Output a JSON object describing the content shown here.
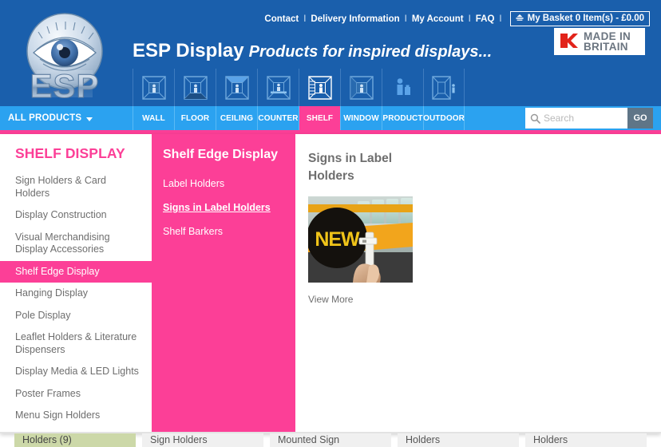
{
  "header": {
    "logo_alt": "ESP eye logo",
    "brand_name": "ESP Display",
    "brand_tagline": "Products for inspired displays...",
    "made_in_britain": {
      "line1": "MADE IN",
      "line2": "BRITAIN"
    },
    "utility_links": [
      {
        "label": "Contact"
      },
      {
        "label": "Delivery Information"
      },
      {
        "label": "My Account"
      },
      {
        "label": "FAQ"
      }
    ],
    "separator": "I",
    "basket": {
      "label": "My Basket 0 Item(s) - £0.00"
    }
  },
  "nav": {
    "all_products_label": "ALL PRODUCTS",
    "items": [
      {
        "label": "WALL",
        "icon": "room-wall-icon",
        "active": false
      },
      {
        "label": "FLOOR",
        "icon": "room-floor-icon",
        "active": false
      },
      {
        "label": "CEILING",
        "icon": "room-ceiling-icon",
        "active": false
      },
      {
        "label": "COUNTER",
        "icon": "room-counter-icon",
        "active": false
      },
      {
        "label": "SHELF",
        "icon": "room-shelf-icon",
        "active": true
      },
      {
        "label": "WINDOW",
        "icon": "room-window-icon",
        "active": false
      },
      {
        "label": "PRODUCT",
        "icon": "product-icon",
        "active": false
      },
      {
        "label": "OUTDOOR",
        "icon": "room-outdoor-icon",
        "active": false
      }
    ]
  },
  "search": {
    "placeholder": "Search",
    "value": "",
    "button_label": "GO"
  },
  "mega_menu": {
    "left": {
      "title": "SHELF DISPLAY",
      "items": [
        {
          "label": "Sign Holders & Card Holders",
          "selected": false
        },
        {
          "label": "Display Construction",
          "selected": false
        },
        {
          "label": "Visual Merchandising Display Accessories",
          "selected": false
        },
        {
          "label": "Shelf Edge Display",
          "selected": true
        },
        {
          "label": "Hanging Display",
          "selected": false
        },
        {
          "label": "Pole Display",
          "selected": false
        },
        {
          "label": "Leaflet Holders & Literature Dispensers",
          "selected": false
        },
        {
          "label": "Display Media & LED Lights",
          "selected": false
        },
        {
          "label": "Poster Frames",
          "selected": false
        },
        {
          "label": "Menu Sign Holders",
          "selected": false
        }
      ]
    },
    "middle": {
      "title": "Shelf Edge Display",
      "items": [
        {
          "label": "Label Holders",
          "current": false
        },
        {
          "label": "Signs in Label Holders",
          "current": true
        },
        {
          "label": "Shelf Barkers",
          "current": false
        }
      ]
    },
    "right": {
      "title": "Signs in Label Holders",
      "thumbnail_alt": "NEW! sign clipped into a shelf label holder",
      "view_more_label": "View More"
    }
  },
  "background_row": [
    {
      "label": "Holders (9)",
      "highlight": true
    },
    {
      "label": "Sign Holders",
      "highlight": false
    },
    {
      "label": "Mounted Sign",
      "highlight": false
    },
    {
      "label": "Holders",
      "highlight": false
    },
    {
      "label": "Holders",
      "highlight": false
    }
  ],
  "colors": {
    "header_blue": "#1a5fac",
    "nav_blue": "#2ba2f0",
    "accent_pink": "#fc3f97",
    "text_grey": "#6e6e6e",
    "go_button": "#5f7587"
  }
}
